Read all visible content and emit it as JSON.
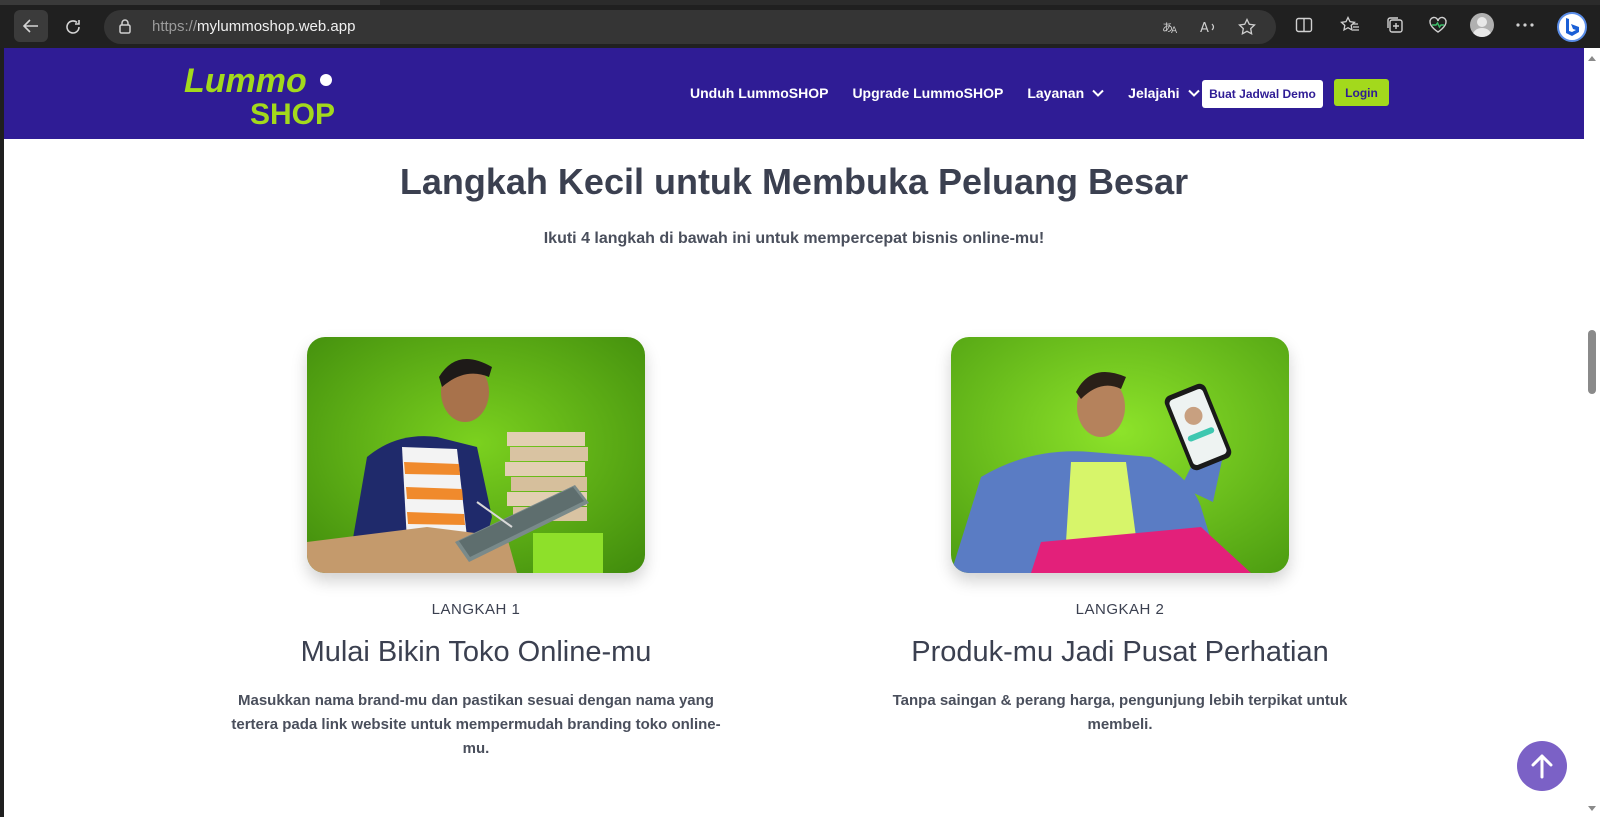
{
  "browser": {
    "url_scheme": "https://",
    "url_host": "mylummoshop.web.app"
  },
  "nav": {
    "logo_top": "Lummo",
    "logo_bottom": "SHOP",
    "links": [
      {
        "label": "Unduh LummoSHOP"
      },
      {
        "label": "Upgrade LummoSHOP"
      },
      {
        "label": "Layanan"
      },
      {
        "label": "Jelajahi"
      }
    ],
    "demo_button": "Buat Jadwal Demo",
    "login_button": "Login"
  },
  "section": {
    "title": "Langkah Kecil untuk Membuka Peluang Besar",
    "subtitle": "Ikuti 4 langkah di bawah ini untuk mempercepat bisnis online-mu!"
  },
  "steps": [
    {
      "label": "LANGKAH 1",
      "title": "Mulai Bikin Toko Online-mu",
      "description": "Masukkan nama brand-mu dan pastikan sesuai dengan nama yang tertera pada link website untuk mempermudah branding toko online-mu."
    },
    {
      "label": "LANGKAH 2",
      "title": "Produk-mu Jadi Pusat Perhatian",
      "description": "Tanpa saingan & perang harga, pengunjung lebih terpikat untuk membeli."
    }
  ],
  "colors": {
    "nav_bg": "#2f1c95",
    "accent_green": "#a3d91c",
    "text_dark": "#3b4050",
    "to_top_button": "#7b61c6"
  }
}
